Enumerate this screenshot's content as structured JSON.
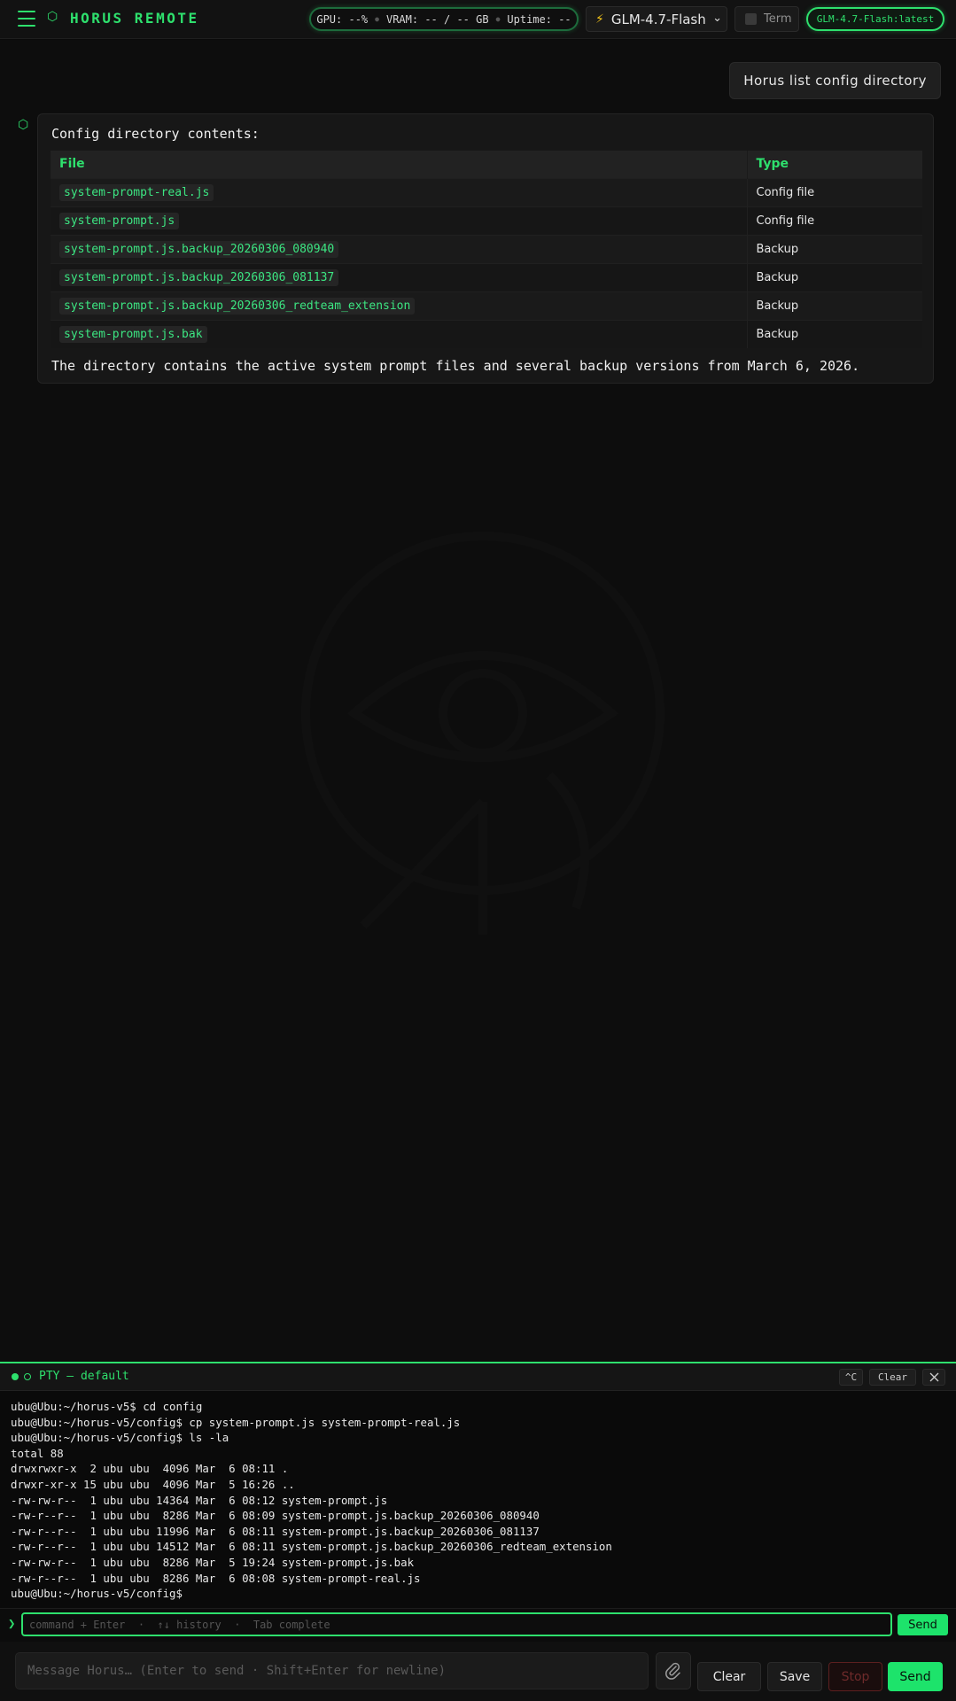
{
  "header": {
    "brand": "HORUS REMOTE",
    "stats": {
      "gpu": "GPU: --%",
      "vram": "VRAM: -- / -- GB",
      "uptime": "Uptime: --"
    },
    "model_select": "GLM-4.7-Flash",
    "term_label": "Term",
    "model_badge": "GLM-4.7-Flash:latest"
  },
  "chat": {
    "user_message": "Horus list config directory",
    "bot": {
      "intro": "Config directory contents:",
      "table": {
        "headers": [
          "File",
          "Type"
        ],
        "rows": [
          {
            "file": "system-prompt-real.js",
            "type": "Config file"
          },
          {
            "file": "system-prompt.js",
            "type": "Config file"
          },
          {
            "file": "system-prompt.js.backup_20260306_080940",
            "type": "Backup"
          },
          {
            "file": "system-prompt.js.backup_20260306_081137",
            "type": "Backup"
          },
          {
            "file": "system-prompt.js.backup_20260306_redteam_extension",
            "type": "Backup"
          },
          {
            "file": "system-prompt.js.bak",
            "type": "Backup"
          }
        ]
      },
      "summary": "The directory contains the active system prompt files and several backup versions from March 6, 2026."
    }
  },
  "terminal": {
    "title": "PTY — default",
    "ctrl_c": "^C",
    "clear": "Clear",
    "lines": [
      "ubu@Ubu:~/horus-v5$ cd config",
      "ubu@Ubu:~/horus-v5/config$ cp system-prompt.js system-prompt-real.js",
      "ubu@Ubu:~/horus-v5/config$ ls -la",
      "total 88",
      "drwxrwxr-x  2 ubu ubu  4096 Mar  6 08:11 .",
      "drwxr-xr-x 15 ubu ubu  4096 Mar  5 16:26 ..",
      "-rw-rw-r--  1 ubu ubu 14364 Mar  6 08:12 system-prompt.js",
      "-rw-r--r--  1 ubu ubu  8286 Mar  6 08:09 system-prompt.js.backup_20260306_080940",
      "-rw-r--r--  1 ubu ubu 11996 Mar  6 08:11 system-prompt.js.backup_20260306_081137",
      "-rw-r--r--  1 ubu ubu 14512 Mar  6 08:11 system-prompt.js.backup_20260306_redteam_extension",
      "-rw-rw-r--  1 ubu ubu  8286 Mar  5 19:24 system-prompt.js.bak",
      "-rw-r--r--  1 ubu ubu  8286 Mar  6 08:08 system-prompt-real.js",
      "ubu@Ubu:~/horus-v5/config$"
    ],
    "command_placeholder": "command + Enter  ·  ↑↓ history  ·  Tab complete",
    "command_send": "Send"
  },
  "composer": {
    "placeholder": "Message Horus… (Enter to send · Shift+Enter for newline)",
    "clear": "Clear",
    "save": "Save",
    "stop": "Stop",
    "send": "Send"
  },
  "colors": {
    "accent": "#2ee06d",
    "background": "#0b0b0b",
    "stop": "#5c1f1f"
  }
}
